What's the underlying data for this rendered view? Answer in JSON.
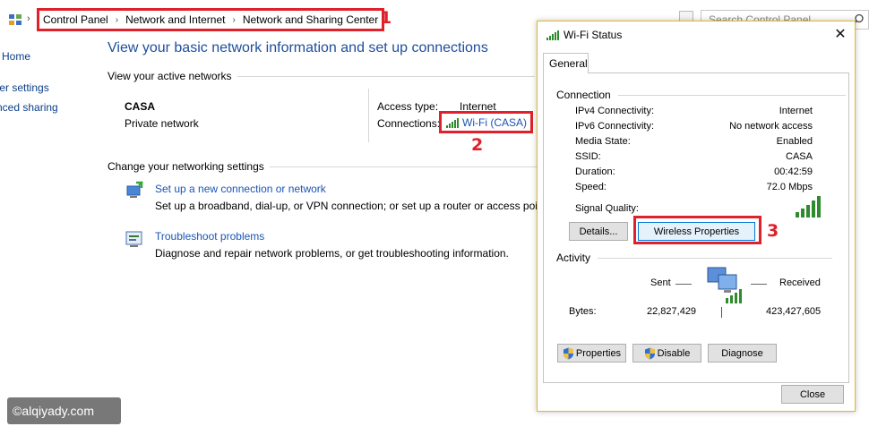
{
  "address_bar": {
    "breadcrumbs": [
      "Control Panel",
      "Network and Internet",
      "Network and Sharing Center"
    ],
    "search_placeholder": "Search Control Panel"
  },
  "callouts": [
    "1",
    "2",
    "3"
  ],
  "left_nav": {
    "items": [
      "l Home",
      "ter settings",
      "nced sharing"
    ]
  },
  "main": {
    "title": "View your basic network information and set up connections",
    "active_networks_heading": "View your active networks",
    "network": {
      "name": "CASA",
      "type": "Private network",
      "access_type_label": "Access type:",
      "access_type_value": "Internet",
      "connections_label": "Connections:",
      "connection_link": "Wi-Fi (CASA)"
    },
    "change_settings_heading": "Change your networking settings",
    "tasks": [
      {
        "link": "Set up a new connection or network",
        "desc": "Set up a broadband, dial-up, or VPN connection; or set up a router or access point.",
        "icon": "new-connection-icon"
      },
      {
        "link": "Troubleshoot problems",
        "desc": "Diagnose and repair network problems, or get troubleshooting information.",
        "icon": "troubleshoot-icon"
      }
    ]
  },
  "watermark": "©alqiyady.com",
  "dialog": {
    "title": "Wi-Fi Status",
    "tab": "General",
    "connection_group": "Connection",
    "status_rows": [
      {
        "label": "IPv4 Connectivity:",
        "value": "Internet"
      },
      {
        "label": "IPv6 Connectivity:",
        "value": "No network access"
      },
      {
        "label": "Media State:",
        "value": "Enabled"
      },
      {
        "label": "SSID:",
        "value": "CASA"
      },
      {
        "label": "Duration:",
        "value": "00:42:59"
      },
      {
        "label": "Speed:",
        "value": "72.0 Mbps"
      }
    ],
    "signal_quality_label": "Signal Quality:",
    "signal_bars": 5,
    "details_button": "Details...",
    "wireless_properties_button": "Wireless Properties",
    "activity_group": "Activity",
    "sent_label": "Sent",
    "received_label": "Received",
    "bytes_label": "Bytes:",
    "bytes_sent": "22,827,429",
    "bytes_received": "423,427,605",
    "properties_button": "Properties",
    "disable_button": "Disable",
    "diagnose_button": "Diagnose",
    "close_button": "Close"
  },
  "colors": {
    "annotation_red": "#e0202a",
    "link_blue": "#1a55b5",
    "title_blue": "#1e4e9c",
    "signal_green": "#2e8b2e",
    "dialog_border": "#e7b820"
  }
}
